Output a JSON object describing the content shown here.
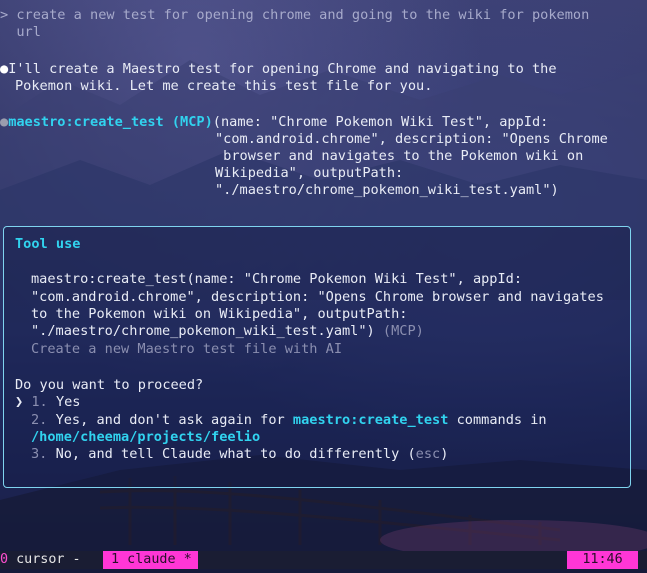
{
  "prompt": {
    "symbol": ">",
    "line1": " create a new test for opening chrome and going to the wiki for pokemon",
    "line2": "  url"
  },
  "assistant_message": {
    "bullet": "●",
    "line1": "I'll create a Maestro test for opening Chrome and navigating to the",
    "line2": "Pokemon wiki. Let me create this test file for you."
  },
  "tool_call": {
    "bullet": "●",
    "name": "maestro:create_test (MCP)",
    "args_line1": "(name: \"Chrome Pokemon Wiki Test\", appId:",
    "args_line2": "\"com.android.chrome\", description: \"Opens Chrome",
    "args_line3": " browser and navigates to the Pokemon wiki on",
    "args_line4": "Wikipedia\", outputPath:",
    "args_line5": "\"./maestro/chrome_pokemon_wiki_test.yaml\")"
  },
  "dialog": {
    "title": "Tool use",
    "detail_line1": "maestro:create_test(name: \"Chrome Pokemon Wiki Test\", appId:",
    "detail_line2": "\"com.android.chrome\", description: \"Opens Chrome browser and navigates",
    "detail_line3": "to the Pokemon wiki on Wikipedia\", outputPath:",
    "detail_line4": "\"./maestro/chrome_pokemon_wiki_test.yaml\")",
    "detail_line4_suffix": " (MCP)",
    "description": "Create a new Maestro test file with AI",
    "question": "Do you want to proceed?",
    "cursor": "❯",
    "options": [
      {
        "number": "1.",
        "text": "Yes"
      },
      {
        "number": "2.",
        "text_before": "Yes, and don't ask again for ",
        "highlight": "maestro:create_test",
        "text_after": " commands in",
        "path": "/home/cheema/projects/feelio"
      },
      {
        "number": "3.",
        "text_before": "No, and tell Claude what to do differently (",
        "key": "esc",
        "text_after": ")"
      }
    ]
  },
  "statusbar": {
    "window0_index": "0",
    "window0_name": " cursor -",
    "window1": " 1 claude *",
    "clock": "11:46"
  },
  "colors": {
    "accent_cyan": "#31d3ef",
    "status_magenta": "#ff36d6",
    "box_border": "#7fd4ef"
  }
}
